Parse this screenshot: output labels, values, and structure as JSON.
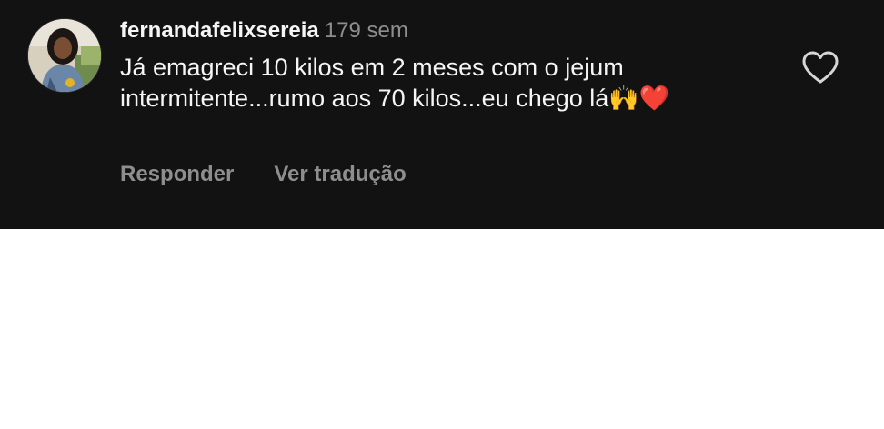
{
  "comment": {
    "username": "fernandafelixsereia",
    "timestamp": "179 sem",
    "text": "Já emagreci 10 kilos em 2 meses com o jejum intermitente...rumo aos 70 kilos...eu chego lá🙌❤️",
    "like_icon": "heart-outline-icon",
    "avatar_icon": "profile-photo"
  },
  "actions": {
    "reply_label": "Responder",
    "translate_label": "Ver tradução"
  },
  "colors": {
    "panel_background": "#121212",
    "primary_text": "#f5f5f5",
    "secondary_text": "#8e8e8e",
    "page_background": "#ffffff"
  }
}
